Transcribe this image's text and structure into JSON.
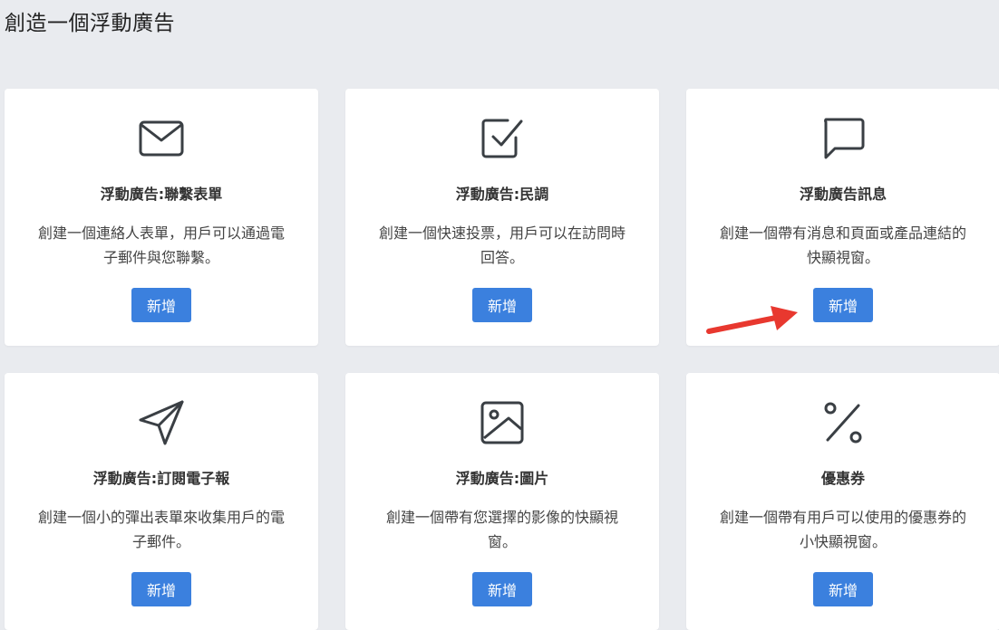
{
  "page": {
    "title": "創造一個浮動廣告"
  },
  "cards": [
    {
      "icon": "envelope-icon",
      "title": "浮動廣告:聯繫表單",
      "desc": "創建一個連絡人表單，用戶可以通過電子郵件與您聯繫。",
      "button": "新增"
    },
    {
      "icon": "checkbox-icon",
      "title": "浮動廣告:民調",
      "desc": "創建一個快速投票，用戶可以在訪問時回答。",
      "button": "新增"
    },
    {
      "icon": "speech-bubble-icon",
      "title": "浮動廣告訊息",
      "desc": "創建一個帶有消息和頁面或產品連結的快顯視窗。",
      "button": "新增"
    },
    {
      "icon": "paper-plane-icon",
      "title": "浮動廣告:訂閱電子報",
      "desc": "創建一個小的彈出表單來收集用戶的電子郵件。",
      "button": "新增"
    },
    {
      "icon": "image-icon",
      "title": "浮動廣告:圖片",
      "desc": "創建一個帶有您選擇的影像的快顯視窗。",
      "button": "新增"
    },
    {
      "icon": "percent-icon",
      "title": "優惠券",
      "desc": "創建一個帶有用戶可以使用的優惠券的小快顯視窗。",
      "button": "新增"
    }
  ],
  "colors": {
    "accent": "#3b80de",
    "background": "#e9ebef",
    "arrow": "#e8382f",
    "icon": "#3a3f44"
  }
}
